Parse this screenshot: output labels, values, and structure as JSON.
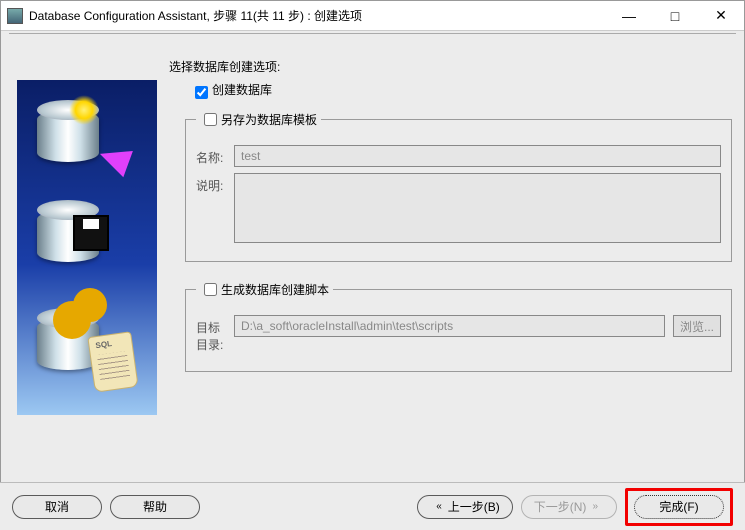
{
  "window": {
    "title": "Database Configuration Assistant, 步骤 11(共 11 步) : 创建选项"
  },
  "main": {
    "heading": "选择数据库创建选项:",
    "create_db": {
      "label": "创建数据库",
      "checked": true
    },
    "save_template": {
      "legend": "另存为数据库模板",
      "checked": false,
      "name_label": "名称:",
      "name_value": "test",
      "desc_label": "说明:",
      "desc_value": ""
    },
    "gen_scripts": {
      "legend": "生成数据库创建脚本",
      "checked": false,
      "dir_label": "目标\n目录:",
      "dir_value": "D:\\a_soft\\oracleInstall\\admin\\test\\scripts",
      "browse_label": "浏览..."
    }
  },
  "footer": {
    "cancel": "取消",
    "help": "帮助",
    "back": "上一步(B)",
    "next": "下一步(N)",
    "finish": "完成(F)"
  }
}
